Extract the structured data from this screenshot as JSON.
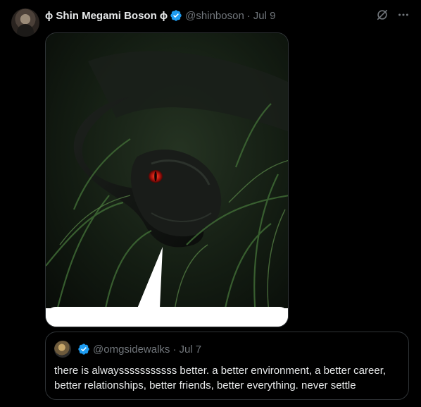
{
  "tweet": {
    "display_name": "ɸ Shin Megami Boson ɸ",
    "handle": "@shinboson",
    "separator": "·",
    "date": "Jul 9"
  },
  "media": {
    "icons": [
      "grok-icon",
      "more-icon"
    ]
  },
  "quoted": {
    "handle": "@omgsidewalks",
    "separator": "·",
    "date": "Jul 7",
    "text": "there is alwaysssssssssss better. a better environment, a better career, better relationships, better friends, better everything. never settle"
  },
  "colors": {
    "background": "#000000",
    "text": "#e7e9ea",
    "muted": "#71767b",
    "border": "#2f3336",
    "verified": "#1d9bf0"
  }
}
